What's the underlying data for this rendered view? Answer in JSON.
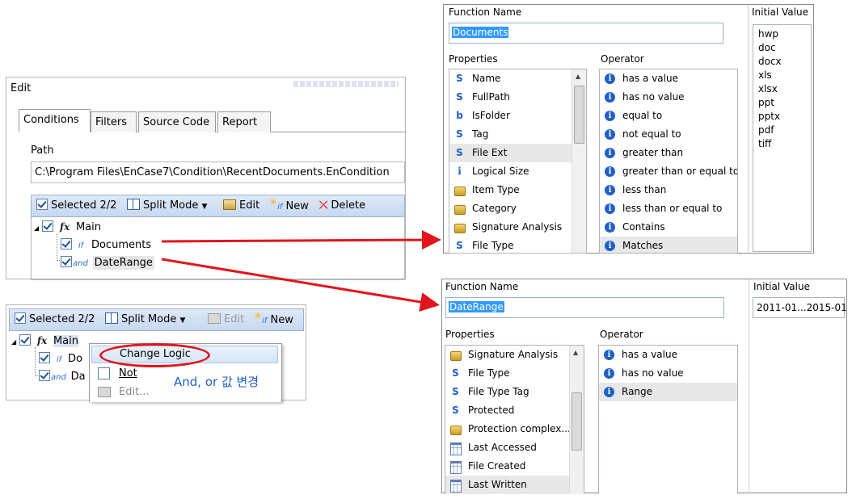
{
  "edit_window": {
    "title": "Edit",
    "tabs": [
      "Conditions",
      "Filters",
      "Source Code",
      "Report"
    ],
    "path_label": "Path",
    "path_value": "C:\\Program Files\\EnCase7\\Condition\\RecentDocuments.EnCondition",
    "toolbar": {
      "selected": "Selected 2/2",
      "split_mode": "Split Mode",
      "edit": "Edit",
      "new": "New",
      "delete": "Delete"
    },
    "tree": {
      "root": "Main",
      "fx": "fx",
      "child1_op": "if",
      "child1": "Documents",
      "child2_op": "and",
      "child2": "DateRange"
    }
  },
  "context_window": {
    "toolbar": {
      "selected": "Selected 2/2",
      "split_mode": "Split Mode",
      "edit": "Edit",
      "new": "New"
    },
    "tree": {
      "root": "Main",
      "fx": "fx",
      "child1_op": "if",
      "child1": "Do",
      "child2_op": "and",
      "child2": "Da"
    },
    "menu": {
      "change_logic": "Change Logic",
      "not": "Not",
      "edit": "Edit..."
    },
    "annotation": "And, or 값 변경"
  },
  "documents_dialog": {
    "function_name_label": "Function Name",
    "function_name_value": "Documents",
    "initial_value_label": "Initial Value",
    "properties_label": "Properties",
    "operator_label": "Operator",
    "properties": [
      {
        "icon": "s",
        "label": "Name"
      },
      {
        "icon": "s",
        "label": "FullPath"
      },
      {
        "icon": "b",
        "label": "IsFolder"
      },
      {
        "icon": "s",
        "label": "Tag"
      },
      {
        "icon": "s",
        "label": "File Ext"
      },
      {
        "icon": "i",
        "label": "Logical Size"
      },
      {
        "icon": "key",
        "label": "Item Type"
      },
      {
        "icon": "key",
        "label": "Category"
      },
      {
        "icon": "key",
        "label": "Signature Analysis"
      },
      {
        "icon": "s",
        "label": "File Type"
      }
    ],
    "operators": [
      "has a value",
      "has no value",
      "equal to",
      "not equal to",
      "greater than",
      "greater than or equal to",
      "less than",
      "less than or equal to",
      "Contains",
      "Matches"
    ],
    "initial_values": [
      "hwp",
      "doc",
      "docx",
      "xls",
      "xlsx",
      "ppt",
      "pptx",
      "pdf",
      "tiff"
    ]
  },
  "daterange_dialog": {
    "function_name_label": "Function Name",
    "function_name_value": "DateRange",
    "initial_value_label": "Initial Value",
    "initial_value": "2011-01...2015-01",
    "properties_label": "Properties",
    "operator_label": "Operator",
    "properties": [
      {
        "icon": "key",
        "label": "Signature Analysis"
      },
      {
        "icon": "s",
        "label": "File Type"
      },
      {
        "icon": "s",
        "label": "File Type Tag"
      },
      {
        "icon": "s",
        "label": "Protected"
      },
      {
        "icon": "key",
        "label": "Protection complex..."
      },
      {
        "icon": "cal",
        "label": "Last Accessed"
      },
      {
        "icon": "cal",
        "label": "File Created"
      },
      {
        "icon": "cal",
        "label": "Last Written"
      }
    ],
    "operators": [
      "has a value",
      "has no value",
      "Range"
    ]
  },
  "colors": {
    "arrow": "#e3141b",
    "highlight_circle": "#e3141b",
    "selection": "#3399ff",
    "annotation": "#1f5fc6"
  }
}
